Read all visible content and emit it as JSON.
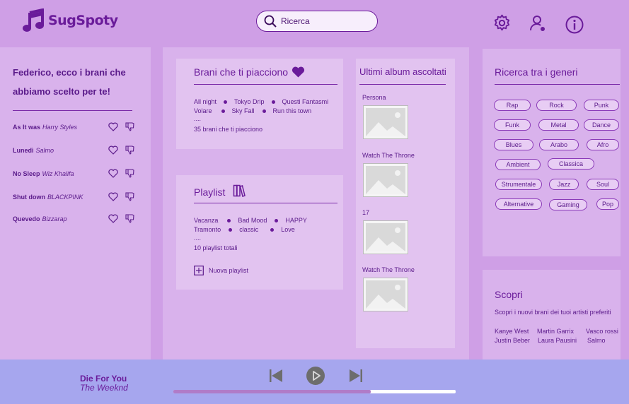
{
  "app": {
    "name": "SugSpoty"
  },
  "search": {
    "placeholder": "Ricerca"
  },
  "header_icons": [
    "gear-icon",
    "user-icon",
    "info-icon"
  ],
  "suggestions": {
    "title_line1": "Federico, ecco i brani che",
    "title_line2": "abbiamo scelto per te!",
    "songs": [
      {
        "title": "As It was",
        "artist": "Harry Styles"
      },
      {
        "title": "Lunedì",
        "artist": "Salmo"
      },
      {
        "title": "No Sleep",
        "artist": "Wiz Khalifa"
      },
      {
        "title": "Shut down",
        "artist": "BLACKPINK"
      },
      {
        "title": "Quevedo",
        "artist": "Bizzarap"
      }
    ]
  },
  "liked": {
    "title": "Brani che ti piacciono",
    "row1": [
      "All night",
      "Tokyo Drip",
      "Questi Fantasmi"
    ],
    "row2": [
      "Volare",
      "Sky Fall",
      "Run this town"
    ],
    "ellipsis": "....",
    "total": "35 brani che ti piacciono"
  },
  "playlist": {
    "title": "Playlist",
    "row1": [
      "Vacanza",
      "Bad Mood",
      "HAPPY"
    ],
    "row2": [
      "Tramonto",
      "classic",
      "Love"
    ],
    "ellipsis": "....",
    "total": "10 playlist totali",
    "new_label": "Nuova playlist"
  },
  "albums": {
    "title": "Ultimi album ascoltati",
    "items": [
      "Persona",
      "Watch The Throne",
      "17",
      "Watch The Throne"
    ]
  },
  "genres": {
    "title": "Ricerca tra i generi",
    "items": [
      "Rap",
      "Rock",
      "Punk",
      "Funk",
      "Metal",
      "Dance",
      "Blues",
      "Arabo",
      "Afro",
      "Ambient",
      "Classica",
      "Strumentale",
      "Jazz",
      "Soul",
      "Alternative",
      "Gaming",
      "Pop"
    ]
  },
  "discover": {
    "title": "Scopri",
    "subtitle": "Scopri i nuovi brani dei tuoi artisti preferiti",
    "row1": [
      "Kanye West",
      "Martin Garrix",
      "Vasco rossi"
    ],
    "row2": [
      "Justin Beber",
      "Laura Pausini",
      "Salmo"
    ]
  },
  "player": {
    "track": "Die For You",
    "artist": "The Weeknd",
    "progress": 0.7
  },
  "colors": {
    "accent": "#6a1b9a",
    "background": "#cf9fe6",
    "player_bg": "#a6a6ee"
  }
}
